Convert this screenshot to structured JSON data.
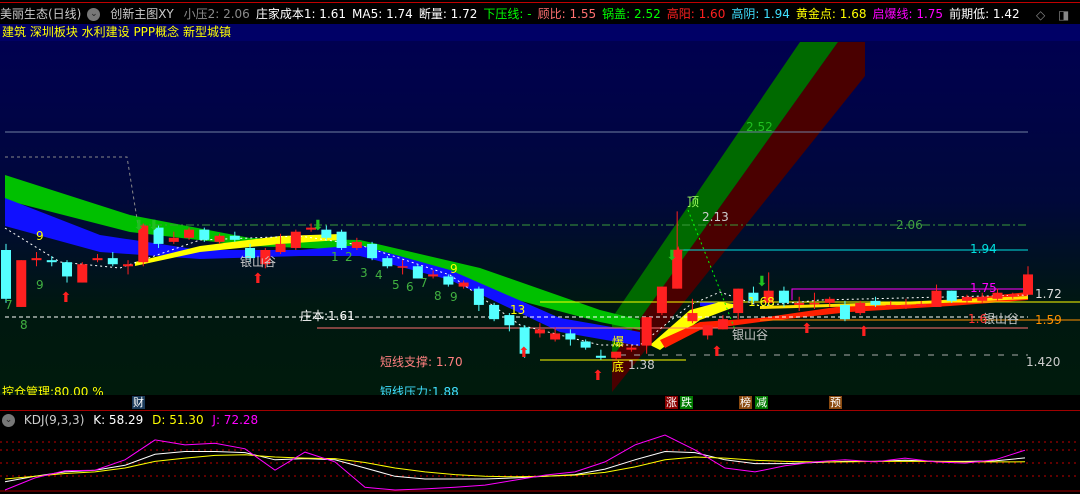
{
  "header": {
    "title": "美丽生态(日线)",
    "indicator": "创新主图XY",
    "items": [
      {
        "label": "小压2: 2.06",
        "color": "#8a8a8a"
      },
      {
        "label": "庄家成本1: 1.61",
        "color": "#ffffff"
      },
      {
        "label": "MA5: 1.74",
        "color": "#ffffff"
      },
      {
        "label": "断量: 1.72",
        "color": "#ffffff"
      },
      {
        "label": "下压线: -",
        "color": "#00ff00"
      },
      {
        "label": "顾比: 1.55",
        "color": "#ff7070"
      },
      {
        "label": "锅盖: 2.52",
        "color": "#00ff00"
      },
      {
        "label": "高阳: 1.60",
        "color": "#ff2020"
      },
      {
        "label": "高阴: 1.94",
        "color": "#40e0ff"
      },
      {
        "label": "黄金点: 1.68",
        "color": "#ffff00"
      },
      {
        "label": "启爆线: 1.75",
        "color": "#ff00ff"
      },
      {
        "label": "前期低: 1.42",
        "color": "#ffffff"
      }
    ]
  },
  "blocks": "建筑 深圳板块 水利建设 PPP概念 新型城镇",
  "annotations": {
    "l252": "2.52",
    "l206": "2.06",
    "l194": "1.94",
    "l175": "1.75",
    "l172": "1.72",
    "l159": "1.59",
    "l142": "1.420",
    "cost": "庄本:1.61",
    "top": "顶",
    "top_val": "2.13",
    "bottom": "底",
    "bottom_val": "1.38",
    "burst": "爆",
    "valley1": "银山谷",
    "valley2": "银山谷",
    "valley3": "银山谷",
    "v168": "1.68",
    "v16": "1.6",
    "support": "短线支撑: 1.70",
    "pressure": "短线压力:1.88",
    "position": "控仓管理:80.00 %",
    "counts": [
      "9",
      "9",
      "7",
      "8",
      "9",
      "1",
      "2",
      "3",
      "4",
      "5",
      "6",
      "7",
      "8",
      "9",
      "9",
      "13"
    ]
  },
  "badges": [
    "财",
    "涨",
    "跌",
    "榜",
    "减",
    "预"
  ],
  "kdj": {
    "name": "KDJ(9,3,3)",
    "k": "K: 58.29",
    "d": "D: 51.30",
    "j": "J: 72.28"
  },
  "colors": {
    "up": "#ff2020",
    "down": "#54ffff",
    "k": "#ffffff",
    "d": "#ffff00",
    "j": "#ff00ff"
  },
  "chart_data": [
    {
      "type": "candlestick",
      "title": "美丽生态(日线)",
      "ylim": [
        1.3,
        2.75
      ],
      "hlines": [
        2.52,
        2.06,
        1.94,
        1.75,
        1.72,
        1.61,
        1.59,
        1.42
      ],
      "candles_ohlc": [
        [
          1.94,
          1.7,
          1.97,
          1.68
        ],
        [
          1.66,
          1.89,
          1.89,
          1.66
        ],
        [
          1.89,
          1.9,
          1.93,
          1.86
        ],
        [
          1.89,
          1.88,
          1.91,
          1.86
        ],
        [
          1.88,
          1.81,
          1.89,
          1.78
        ],
        [
          1.78,
          1.87,
          1.88,
          1.78
        ],
        [
          1.89,
          1.9,
          1.92,
          1.88
        ],
        [
          1.9,
          1.87,
          1.93,
          1.86
        ],
        [
          1.86,
          1.87,
          1.89,
          1.82
        ],
        [
          1.88,
          2.06,
          2.07,
          1.86
        ],
        [
          2.05,
          1.97,
          2.06,
          1.95
        ],
        [
          1.98,
          2.0,
          2.03,
          1.97
        ],
        [
          2.0,
          2.04,
          2.05,
          1.99
        ],
        [
          2.04,
          1.99,
          2.05,
          1.98
        ],
        [
          1.98,
          2.01,
          2.02,
          1.97
        ],
        [
          2.01,
          1.99,
          2.03,
          1.98
        ],
        [
          1.95,
          1.9,
          1.97,
          1.88
        ],
        [
          1.87,
          1.94,
          1.95,
          1.85
        ],
        [
          1.93,
          1.97,
          2.02,
          1.92
        ],
        [
          1.95,
          2.03,
          2.04,
          1.94
        ],
        [
          2.04,
          2.05,
          2.07,
          2.03
        ],
        [
          2.04,
          2.0,
          2.06,
          1.99
        ],
        [
          2.03,
          1.95,
          2.04,
          1.94
        ],
        [
          1.95,
          1.98,
          2.0,
          1.94
        ],
        [
          1.97,
          1.9,
          1.98,
          1.89
        ],
        [
          1.9,
          1.86,
          1.91,
          1.85
        ],
        [
          1.86,
          1.86,
          1.89,
          1.82
        ],
        [
          1.86,
          1.8,
          1.87,
          1.8
        ],
        [
          1.81,
          1.82,
          1.84,
          1.8
        ],
        [
          1.81,
          1.77,
          1.82,
          1.76
        ],
        [
          1.76,
          1.78,
          1.79,
          1.75
        ],
        [
          1.75,
          1.67,
          1.76,
          1.64
        ],
        [
          1.67,
          1.6,
          1.68,
          1.59
        ],
        [
          1.62,
          1.57,
          1.63,
          1.54
        ],
        [
          1.56,
          1.43,
          1.57,
          1.41
        ],
        [
          1.53,
          1.55,
          1.58,
          1.51
        ],
        [
          1.5,
          1.53,
          1.56,
          1.49
        ],
        [
          1.53,
          1.5,
          1.55,
          1.47
        ],
        [
          1.49,
          1.46,
          1.5,
          1.45
        ],
        [
          1.42,
          1.41,
          1.45,
          1.4
        ],
        [
          1.41,
          1.44,
          1.44,
          1.4
        ],
        [
          1.45,
          1.46,
          1.47,
          1.44
        ],
        [
          1.47,
          1.61,
          1.61,
          1.43
        ],
        [
          1.63,
          1.76,
          1.76,
          1.62
        ],
        [
          1.75,
          1.94,
          2.13,
          1.75
        ],
        [
          1.59,
          1.63,
          1.7,
          1.58
        ],
        [
          1.52,
          1.57,
          1.57,
          1.5
        ],
        [
          1.55,
          1.6,
          1.62,
          1.55
        ],
        [
          1.63,
          1.75,
          1.75,
          1.6
        ],
        [
          1.73,
          1.69,
          1.76,
          1.68
        ],
        [
          1.68,
          1.74,
          1.83,
          1.68
        ],
        [
          1.74,
          1.68,
          1.76,
          1.66
        ],
        [
          1.67,
          1.68,
          1.71,
          1.64
        ],
        [
          1.68,
          1.68,
          1.73,
          1.65
        ],
        [
          1.68,
          1.7,
          1.71,
          1.66
        ],
        [
          1.67,
          1.6,
          1.69,
          1.59
        ],
        [
          1.63,
          1.68,
          1.69,
          1.62
        ],
        [
          1.69,
          1.67,
          1.71,
          1.66
        ],
        [
          1.67,
          1.67,
          1.69,
          1.66
        ],
        [
          1.67,
          1.67,
          1.7,
          1.65
        ],
        [
          1.665,
          1.675,
          1.69,
          1.66
        ],
        [
          1.66,
          1.74,
          1.77,
          1.66
        ],
        [
          1.74,
          1.69,
          1.74,
          1.68
        ],
        [
          1.69,
          1.71,
          1.72,
          1.68
        ],
        [
          1.69,
          1.71,
          1.73,
          1.68
        ],
        [
          1.7,
          1.73,
          1.75,
          1.69
        ],
        [
          1.71,
          1.72,
          1.73,
          1.7
        ],
        [
          1.72,
          1.82,
          1.86,
          1.72
        ]
      ]
    },
    {
      "type": "line",
      "title": "KDJ(9,3,3)",
      "ylim": [
        0,
        100
      ],
      "series": [
        {
          "name": "K",
          "values": [
            15,
            25,
            33,
            36,
            45,
            65,
            70,
            70,
            68,
            55,
            57,
            55,
            40,
            25,
            20,
            20,
            20,
            22,
            25,
            28,
            38,
            55,
            70,
            68,
            55,
            48,
            48,
            50,
            52,
            52,
            54,
            52,
            52,
            53,
            58.29
          ]
        },
        {
          "name": "D",
          "values": [
            20,
            25,
            30,
            33,
            40,
            52,
            58,
            63,
            64,
            60,
            58,
            57,
            50,
            40,
            33,
            28,
            25,
            24,
            25,
            27,
            32,
            42,
            55,
            60,
            58,
            54,
            52,
            51,
            51,
            52,
            52,
            52,
            51,
            51,
            51.3
          ]
        },
        {
          "name": "J",
          "values": [
            0,
            22,
            35,
            36,
            55,
            91,
            82,
            85,
            75,
            36,
            69,
            51,
            5,
            0,
            2,
            5,
            9,
            18,
            27,
            33,
            51,
            82,
            100,
            73,
            40,
            33,
            44,
            51,
            55,
            51,
            58,
            51,
            49,
            55,
            72.28
          ]
        }
      ]
    }
  ]
}
